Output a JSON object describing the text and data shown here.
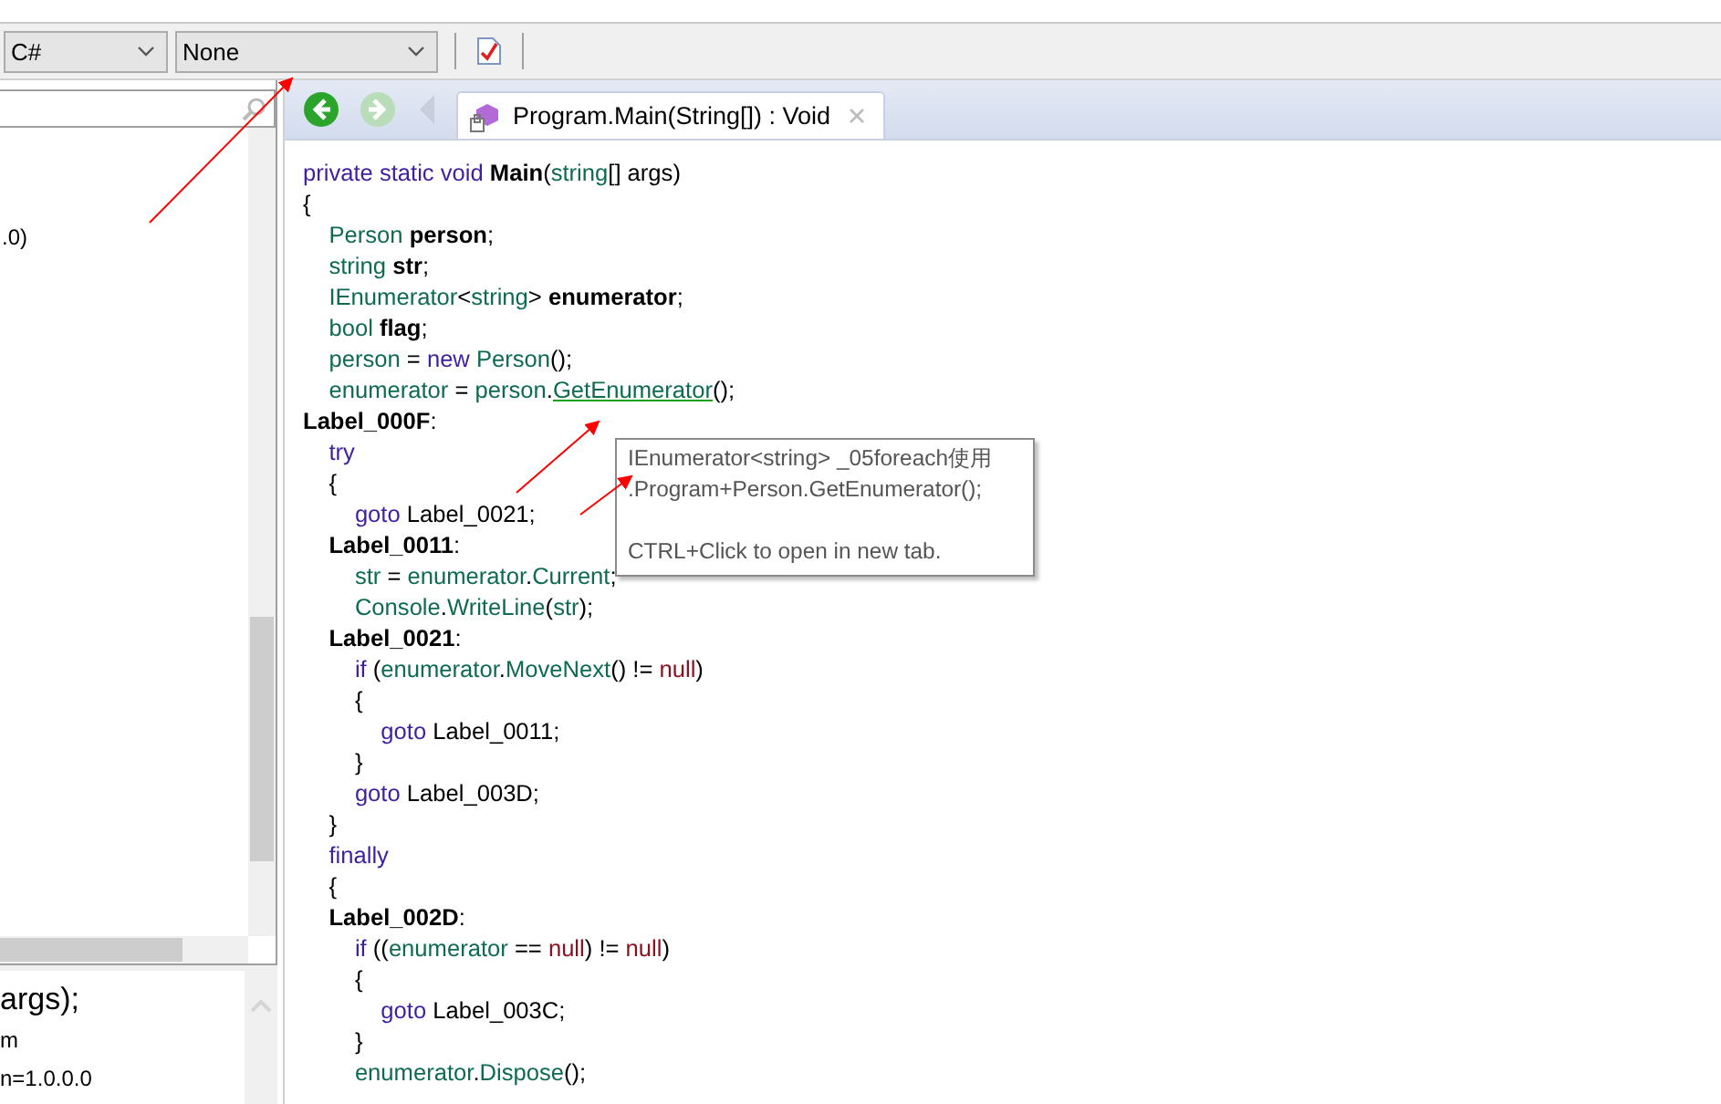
{
  "toolbar": {
    "language_combo": {
      "value": "C#"
    },
    "optimization_combo": {
      "value": "None"
    }
  },
  "left_panel": {
    "tree_fragments": [
      ".0)"
    ],
    "details_fragments": [
      {
        "text": "args);",
        "kind": "large"
      },
      {
        "text": "m",
        "kind": "small"
      },
      {
        "text": "n=1.0.0.0",
        "kind": "small"
      }
    ]
  },
  "editor": {
    "back_enabled": true,
    "forward_enabled": false,
    "tabs": [
      {
        "label": "Program.Main(String[]) : Void",
        "selected": true
      }
    ],
    "code_lines": [
      [
        {
          "kind": "keyword",
          "text": "private static void "
        },
        {
          "kind": "decl",
          "text": "Main"
        },
        {
          "kind": "plain",
          "text": "("
        },
        {
          "kind": "type",
          "text": "string"
        },
        {
          "kind": "plain",
          "text": "[] args)"
        }
      ],
      [
        {
          "kind": "plain",
          "text": "{"
        }
      ],
      [
        {
          "kind": "type",
          "text": "    Person "
        },
        {
          "kind": "decl",
          "text": "person"
        },
        {
          "kind": "plain",
          "text": ";"
        }
      ],
      [
        {
          "kind": "type",
          "text": "    string "
        },
        {
          "kind": "decl",
          "text": "str"
        },
        {
          "kind": "plain",
          "text": ";"
        }
      ],
      [
        {
          "kind": "type",
          "text": "    IEnumerator"
        },
        {
          "kind": "plain",
          "text": "<"
        },
        {
          "kind": "type",
          "text": "string"
        },
        {
          "kind": "plain",
          "text": "> "
        },
        {
          "kind": "decl",
          "text": "enumerator"
        },
        {
          "kind": "plain",
          "text": ";"
        }
      ],
      [
        {
          "kind": "type",
          "text": "    bool "
        },
        {
          "kind": "decl",
          "text": "flag"
        },
        {
          "kind": "plain",
          "text": ";"
        }
      ],
      [
        {
          "kind": "type",
          "text": "    person"
        },
        {
          "kind": "plain",
          "text": " = "
        },
        {
          "kind": "keyword",
          "text": "new "
        },
        {
          "kind": "type",
          "text": "Person"
        },
        {
          "kind": "plain",
          "text": "();"
        }
      ],
      [
        {
          "kind": "type",
          "text": "    enumerator"
        },
        {
          "kind": "plain",
          "text": " = "
        },
        {
          "kind": "type",
          "text": "person"
        },
        {
          "kind": "plain",
          "text": "."
        },
        {
          "kind": "link",
          "text": "GetEnumerator"
        },
        {
          "kind": "plain",
          "text": "();"
        }
      ],
      [
        {
          "kind": "decl",
          "text": "Label_000F"
        },
        {
          "kind": "plain",
          "text": ":"
        }
      ],
      [
        {
          "kind": "keyword",
          "text": "    try"
        }
      ],
      [
        {
          "kind": "plain",
          "text": "    {"
        }
      ],
      [
        {
          "kind": "keyword",
          "text": "        goto "
        },
        {
          "kind": "plain",
          "text": "Label_0021;"
        }
      ],
      [
        {
          "kind": "decl",
          "text": "    Label_0011"
        },
        {
          "kind": "plain",
          "text": ":"
        }
      ],
      [
        {
          "kind": "type",
          "text": "        str"
        },
        {
          "kind": "plain",
          "text": " = "
        },
        {
          "kind": "type",
          "text": "enumerator"
        },
        {
          "kind": "plain",
          "text": "."
        },
        {
          "kind": "type",
          "text": "Current"
        },
        {
          "kind": "plain",
          "text": ";"
        }
      ],
      [
        {
          "kind": "type",
          "text": "        Console"
        },
        {
          "kind": "plain",
          "text": "."
        },
        {
          "kind": "type",
          "text": "WriteLine"
        },
        {
          "kind": "plain",
          "text": "("
        },
        {
          "kind": "type",
          "text": "str"
        },
        {
          "kind": "plain",
          "text": ");"
        }
      ],
      [
        {
          "kind": "decl",
          "text": "    Label_0021"
        },
        {
          "kind": "plain",
          "text": ":"
        }
      ],
      [
        {
          "kind": "keyword",
          "text": "        if "
        },
        {
          "kind": "plain",
          "text": "("
        },
        {
          "kind": "type",
          "text": "enumerator"
        },
        {
          "kind": "plain",
          "text": "."
        },
        {
          "kind": "type",
          "text": "MoveNext"
        },
        {
          "kind": "plain",
          "text": "() != "
        },
        {
          "kind": "null",
          "text": "null"
        },
        {
          "kind": "plain",
          "text": ")"
        }
      ],
      [
        {
          "kind": "plain",
          "text": "        {"
        }
      ],
      [
        {
          "kind": "keyword",
          "text": "            goto "
        },
        {
          "kind": "plain",
          "text": "Label_0011;"
        }
      ],
      [
        {
          "kind": "plain",
          "text": "        }"
        }
      ],
      [
        {
          "kind": "keyword",
          "text": "        goto "
        },
        {
          "kind": "plain",
          "text": "Label_003D;"
        }
      ],
      [
        {
          "kind": "plain",
          "text": "    }"
        }
      ],
      [
        {
          "kind": "keyword",
          "text": "    finally"
        }
      ],
      [
        {
          "kind": "plain",
          "text": "    {"
        }
      ],
      [
        {
          "kind": "decl",
          "text": "    Label_002D"
        },
        {
          "kind": "plain",
          "text": ":"
        }
      ],
      [
        {
          "kind": "keyword",
          "text": "        if "
        },
        {
          "kind": "plain",
          "text": "(("
        },
        {
          "kind": "type",
          "text": "enumerator"
        },
        {
          "kind": "plain",
          "text": " == "
        },
        {
          "kind": "null",
          "text": "null"
        },
        {
          "kind": "plain",
          "text": ") != "
        },
        {
          "kind": "null",
          "text": "null"
        },
        {
          "kind": "plain",
          "text": ")"
        }
      ],
      [
        {
          "kind": "plain",
          "text": "        {"
        }
      ],
      [
        {
          "kind": "keyword",
          "text": "            goto "
        },
        {
          "kind": "plain",
          "text": "Label_003C;"
        }
      ],
      [
        {
          "kind": "plain",
          "text": "        }"
        }
      ],
      [
        {
          "kind": "type",
          "text": "        enumerator"
        },
        {
          "kind": "plain",
          "text": "."
        },
        {
          "kind": "type",
          "text": "Dispose"
        },
        {
          "kind": "plain",
          "text": "();"
        }
      ]
    ],
    "tooltip": {
      "lines": [
        {
          "kind": "signature",
          "text": "IEnumerator<string> _05foreach使用"
        },
        {
          "kind": "signature",
          "text": ".Program+Person.GetEnumerator();"
        },
        {
          "kind": "hint",
          "text": "CTRL+Click to open in new tab."
        }
      ]
    }
  }
}
